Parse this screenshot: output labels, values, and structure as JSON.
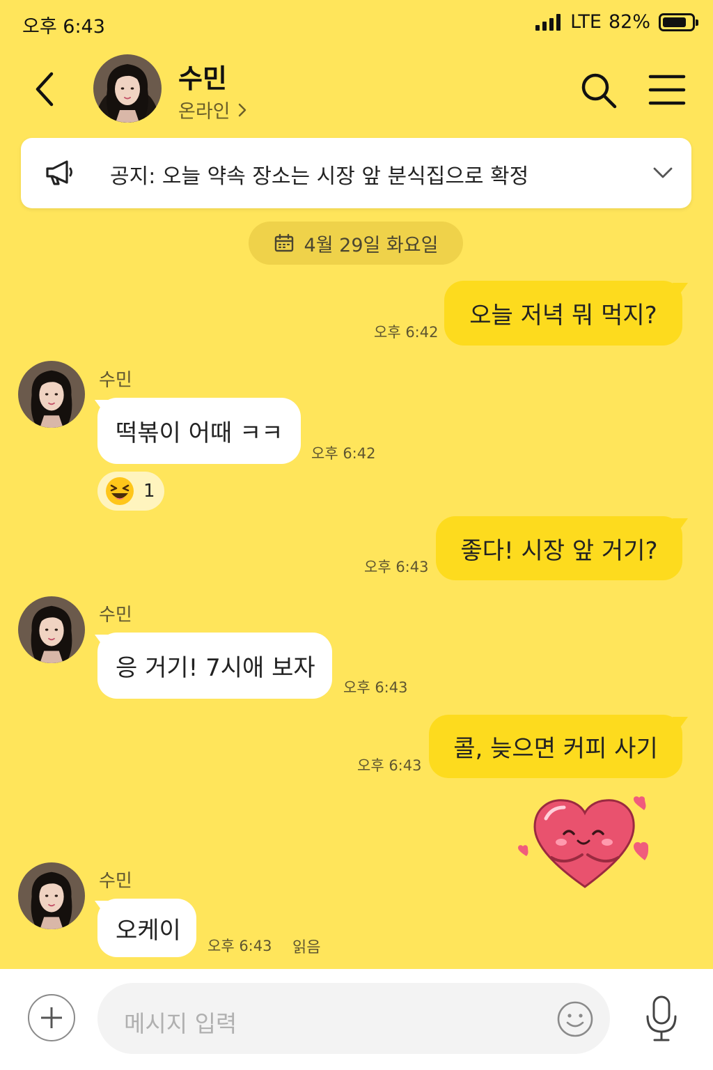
{
  "status_bar": {
    "time": "오후 6:43",
    "network": "LTE",
    "battery": "82%",
    "battery_level": 0.82
  },
  "header": {
    "name": "수민",
    "status": "온라인"
  },
  "notice": {
    "text": "공지: 오늘 약속 장소는 시장 앞 분식집으로 확정"
  },
  "date_divider": "4월 29일 화요일",
  "messages": [
    {
      "type": "sent",
      "text": "오늘 저녁 뭐 먹지?",
      "time": "오후 6:42"
    },
    {
      "type": "received",
      "sender": "수민",
      "text": "떡볶이 어때 ㅋㅋ",
      "time": "오후 6:42",
      "reaction": {
        "icon": "laughing-emoji",
        "count": "1"
      }
    },
    {
      "type": "sent",
      "text": "좋다! 시장 앞 거기?",
      "time": "오후 6:43"
    },
    {
      "type": "received",
      "sender": "수민",
      "text": "응 거기! 7시애 보자",
      "time": "오후 6:43"
    },
    {
      "type": "sent",
      "text": "콜, 늦으면 커피 사기",
      "time": "오후 6:43"
    },
    {
      "type": "sticker",
      "icon": "heart-hug-sticker"
    },
    {
      "type": "received",
      "sender": "수민",
      "text": "오케이",
      "time": "오후 6:43",
      "read_label": "읽음"
    }
  ],
  "input": {
    "placeholder": "메시지 입력"
  },
  "colors": {
    "background": "#FFE55B",
    "sent_bubble": "#FDDB1E",
    "received_bubble": "#FFFFFF",
    "input_bar": "#FFFFFF"
  }
}
